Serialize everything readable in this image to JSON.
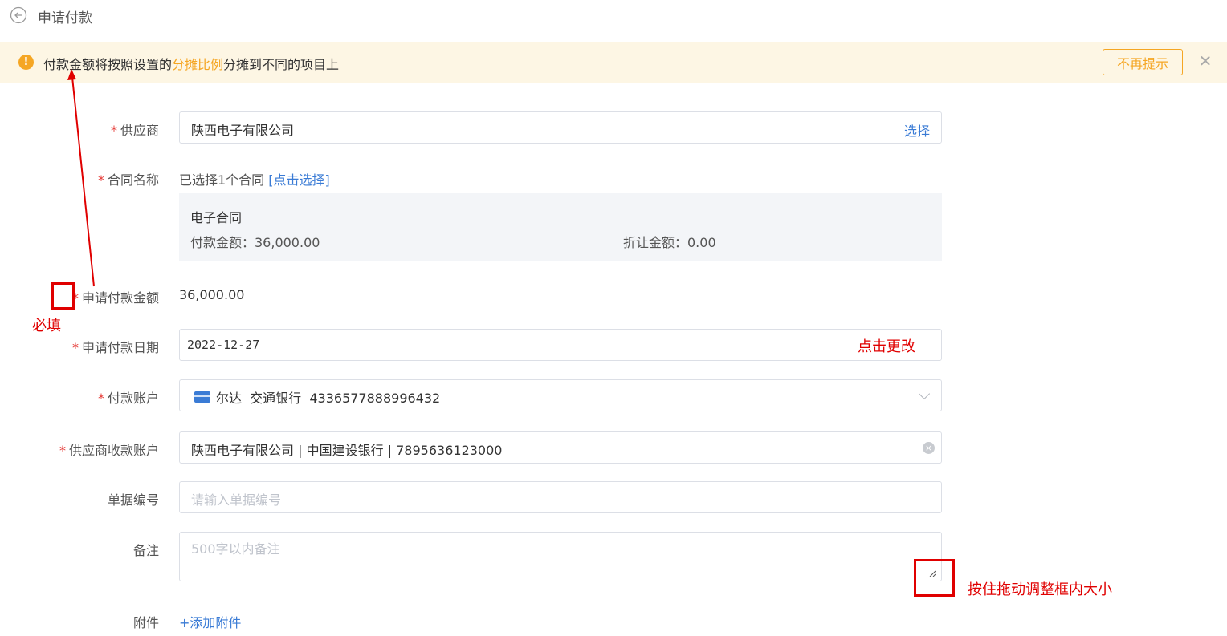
{
  "header": {
    "title": "申请付款"
  },
  "notice": {
    "text_before": "付款金额将按照设置的",
    "text_highlight": "分摊比例",
    "text_after": "分摊到不同的项目上",
    "dismiss_label": "不再提示",
    "close_symbol": "✕"
  },
  "form": {
    "required_mark": "*",
    "supplier": {
      "label": "供应商",
      "value": "陕西电子有限公司",
      "action": "选择"
    },
    "contract": {
      "label": "合同名称",
      "summary": "已选择1个合同",
      "action": "[点击选择]",
      "card": {
        "name": "电子合同",
        "amount": "付款金额：36,000.00",
        "discount": "折让金额：0.00"
      }
    },
    "amount": {
      "label": "申请付款金额",
      "value": "36,000.00"
    },
    "date": {
      "label": "申请付款日期",
      "value": "2022-12-27"
    },
    "pay_account": {
      "label": "付款账户",
      "value": "尔达  交通银行  4336577888996432"
    },
    "receive_account": {
      "label": "供应商收款账户",
      "value": "陕西电子有限公司 | 中国建设银行 | 7895636123000",
      "clear_symbol": "×"
    },
    "doc_no": {
      "label": "单据编号",
      "placeholder": "请输入单据编号"
    },
    "remark": {
      "label": "备注",
      "placeholder": "500字以内备注"
    },
    "attachment": {
      "label": "附件",
      "action": "+添加附件"
    }
  },
  "annotations": {
    "required": "必填",
    "click_change": "点击更改",
    "resize": "按住拖动调整框内大小"
  },
  "colors": {
    "accent": "#3a7bd5",
    "warning": "#f5a623",
    "required": "#e53935",
    "annotation": "#e00000"
  }
}
